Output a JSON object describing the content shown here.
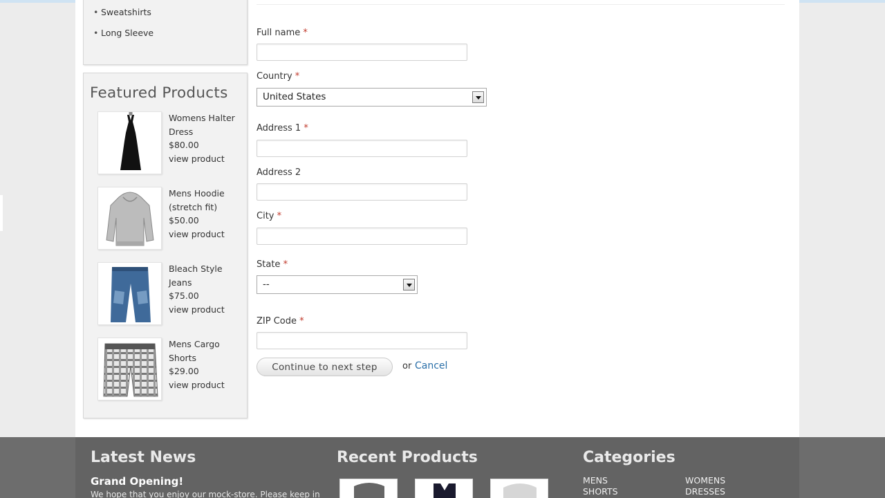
{
  "sidebar": {
    "categories": [
      "Sweatshirts",
      "Long Sleeve"
    ],
    "featured_title": "Featured Products",
    "featured": [
      {
        "name_line1": "Womens Halter",
        "name_line2": "Dress",
        "price": "$80.00",
        "link": "view product",
        "icon": "halter-dress-image"
      },
      {
        "name_line1": "Mens Hoodie",
        "name_line2": "(stretch fit)",
        "price": "$50.00",
        "link": "view product",
        "icon": "hoodie-image"
      },
      {
        "name_line1": "Bleach Style",
        "name_line2": "Jeans",
        "price": "$75.00",
        "link": "view product",
        "icon": "jeans-image"
      },
      {
        "name_line1": "Mens Cargo",
        "name_line2": "Shorts",
        "price": "$29.00",
        "link": "view product",
        "icon": "cargo-shorts-image"
      }
    ]
  },
  "form": {
    "required_mark": "*",
    "full_name": {
      "label": "Full name",
      "value": ""
    },
    "country": {
      "label": "Country",
      "value": "United States"
    },
    "address1": {
      "label": "Address 1",
      "value": ""
    },
    "address2": {
      "label": "Address 2",
      "value": ""
    },
    "city": {
      "label": "City",
      "value": ""
    },
    "state": {
      "label": "State",
      "value": "--"
    },
    "zip": {
      "label": "ZIP Code",
      "value": ""
    },
    "continue_label": "Continue to next step",
    "or_text": "or",
    "cancel_label": "Cancel"
  },
  "footer": {
    "news_heading": "Latest News",
    "news_title": "Grand Opening!",
    "news_text": "We hope that you enjoy our mock-store.  Please keep in",
    "recent_heading": "Recent Products",
    "categories_heading": "Categories",
    "categories": [
      {
        "line1": "MENS",
        "line2": "SHORTS"
      },
      {
        "line1": "WOMENS",
        "line2": "DRESSES"
      }
    ]
  },
  "colors": {
    "required": "#c0392b",
    "link": "#2a6fa8",
    "footer_bg": "#636363"
  }
}
